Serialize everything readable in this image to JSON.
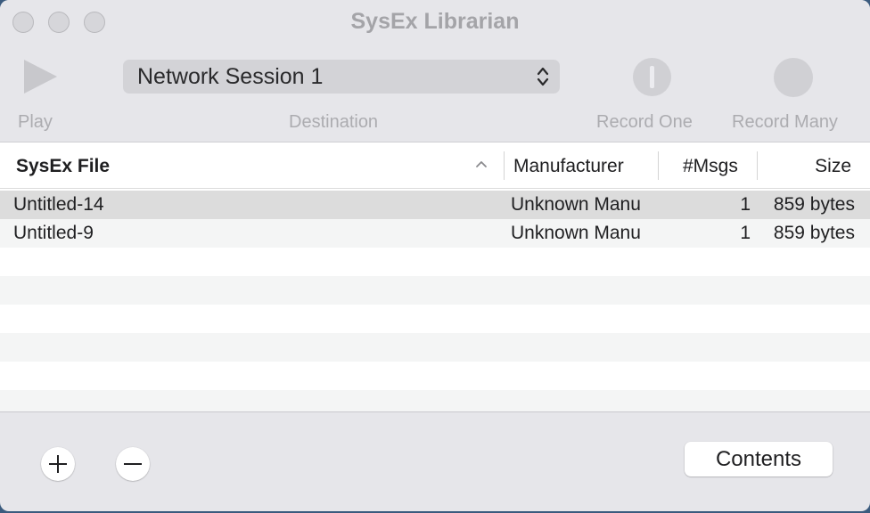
{
  "window": {
    "title": "SysEx Librarian"
  },
  "toolbar": {
    "play_label": "Play",
    "destination_label": "Destination",
    "destination_value": "Network Session 1",
    "record_one_label": "Record One",
    "record_many_label": "Record Many"
  },
  "table": {
    "columns": [
      "SysEx File",
      "Manufacturer",
      "#Msgs",
      "Size"
    ],
    "sort_column": "SysEx File",
    "sort_direction": "ascending",
    "rows": [
      {
        "file": "Untitled-14",
        "manufacturer": "Unknown Manu",
        "msgs": "1",
        "size": "859 bytes",
        "selected": true
      },
      {
        "file": "Untitled-9",
        "manufacturer": "Unknown Manu",
        "msgs": "1",
        "size": "859 bytes",
        "selected": false
      }
    ]
  },
  "footer": {
    "add_icon": "plus-icon",
    "remove_icon": "minus-icon",
    "contents_label": "Contents"
  },
  "colors": {
    "selected_row": "#dcdcdc",
    "alt_row": "#f4f5f5",
    "window_bg": "#e6e6ea"
  }
}
